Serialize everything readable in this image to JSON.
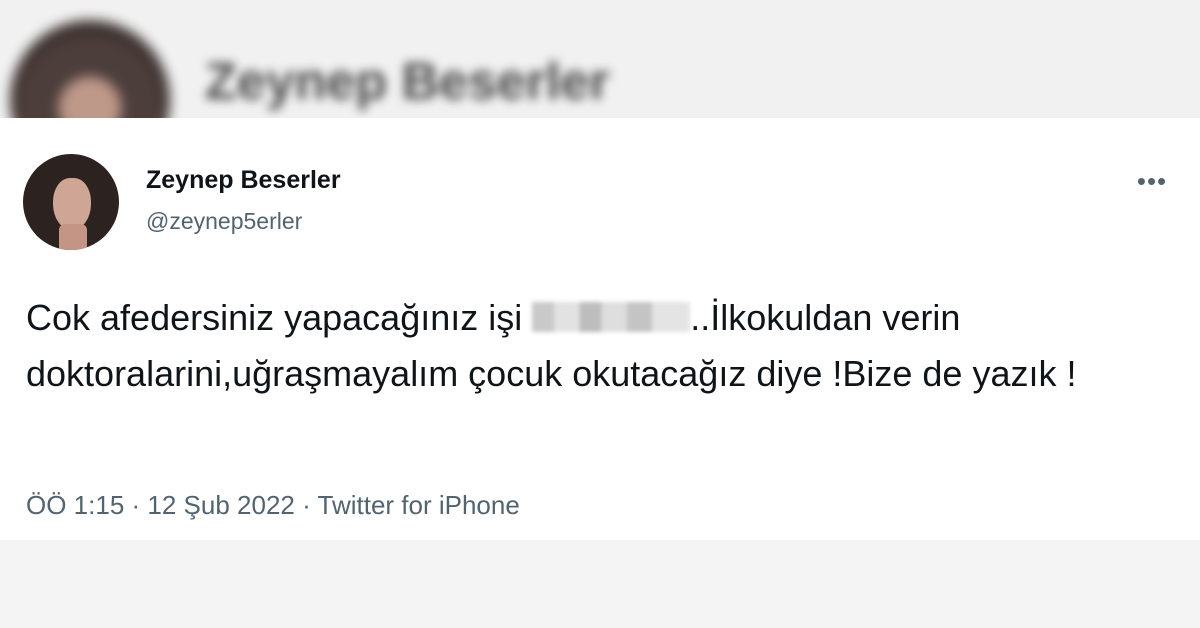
{
  "tweet": {
    "display_name": "Zeynep Beserler",
    "handle": "@zeynep5erler",
    "more_icon": "more-dots-icon",
    "text": {
      "part1": "Cok afedersiniz yapacağınız işi ",
      "part2": "..İlkokuldan verin doktoralarini,uğraşmayalım çocuk okutacağız diye !Bize de yazık !"
    },
    "time": "ÖÖ 1:15",
    "date": "12 Şub 2022",
    "separator": " · ",
    "source": "Twitter for iPhone"
  },
  "background": {
    "top_name": "Zeynep Beserler"
  }
}
